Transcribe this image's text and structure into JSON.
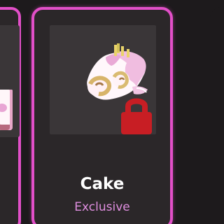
{
  "item": {
    "name": "Cake",
    "rarity": "Exclusive",
    "locked": true,
    "icon": "cake-icon"
  },
  "colors": {
    "background": "#1d1a1c",
    "card": "#2b2729",
    "card_border": "#e24fc8",
    "image_bg": "#3a3638",
    "lock": "#c81e24",
    "rarity_text": "#e08fe0"
  }
}
